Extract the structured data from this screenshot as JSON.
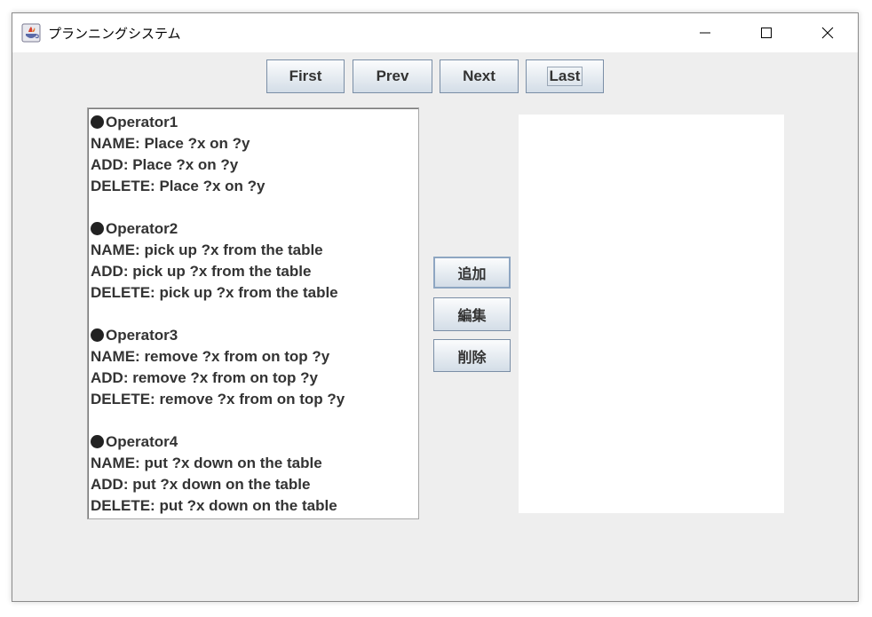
{
  "window": {
    "title": "プランニングシステム",
    "icon": "java-coffee-icon"
  },
  "nav": {
    "first": "First",
    "prev": "Prev",
    "next": "Next",
    "last": "Last"
  },
  "operators": [
    {
      "header": "Operator1",
      "lines": [
        "NAME: Place ?x on ?y",
        "ADD: Place ?x on ?y",
        "DELETE: Place ?x on ?y"
      ]
    },
    {
      "header": "Operator2",
      "lines": [
        "NAME: pick up ?x from the table",
        "ADD: pick up ?x from the table",
        "DELETE: pick up ?x from the table"
      ]
    },
    {
      "header": "Operator3",
      "lines": [
        "NAME: remove ?x from on top ?y",
        "ADD: remove ?x from on top ?y",
        "DELETE: remove ?x from on top ?y"
      ]
    },
    {
      "header": "Operator4",
      "lines": [
        "NAME: put ?x down on the table",
        "ADD: put ?x down on the table",
        "DELETE: put ?x down on the table"
      ]
    }
  ],
  "actions": {
    "add": "追加",
    "edit": "編集",
    "delete": "削除"
  },
  "colors": {
    "window_bg": "#eeeeee",
    "text": "#333333",
    "button_border": "#7a8ea6"
  }
}
